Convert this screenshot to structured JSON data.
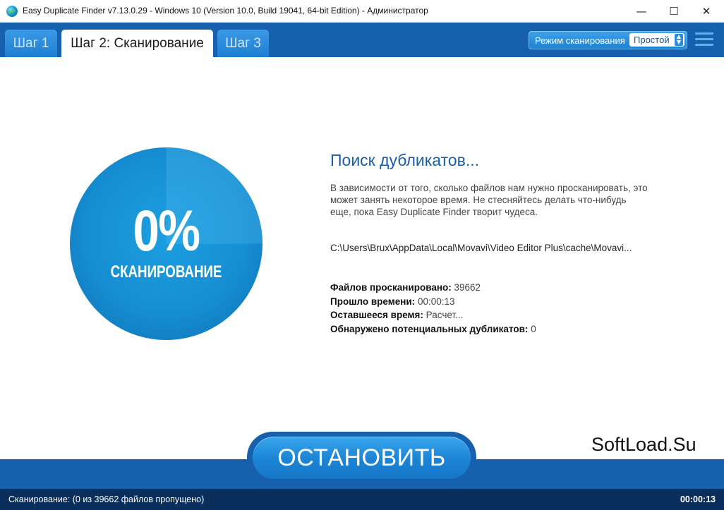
{
  "window": {
    "title": "Easy Duplicate Finder v7.13.0.29 - Windows 10 (Version 10.0, Build 19041, 64-bit Edition) - Администратор",
    "minimize_glyph": "—",
    "maximize_glyph": "☐",
    "close_glyph": "✕"
  },
  "tabs": [
    {
      "label": "Шаг 1",
      "active": false
    },
    {
      "label": "Шаг 2: Сканирование",
      "active": true
    },
    {
      "label": "Шаг 3",
      "active": false
    }
  ],
  "scan_mode": {
    "label": "Режим сканирования",
    "value": "Простой"
  },
  "progress": {
    "percent_text": "0%",
    "percent_value": 0,
    "label": "СКАНИРОВАНИЕ"
  },
  "info": {
    "heading": "Поиск дубликатов...",
    "description": "В зависимости от того, сколько файлов нам нужно просканировать, это может занять некоторое время. Не стесняйтесь делать что-нибудь еще, пока Easy Duplicate Finder творит чудеса.",
    "current_path": "C:\\Users\\Brux\\AppData\\Local\\Movavi\\Video Editor Plus\\cache\\Movavi..."
  },
  "stats": {
    "scanned_label": "Файлов просканировано:",
    "scanned_value": "39662",
    "elapsed_label": "Прошло времени:",
    "elapsed_value": "00:00:13",
    "remaining_label": "Оставшееся время:",
    "remaining_value": "Расчет...",
    "duplicates_label": "Обнаружено потенциальных дубликатов:",
    "duplicates_value": "0"
  },
  "stop_button": "ОСТАНОВИТЬ",
  "watermark": "SoftLoad.Su",
  "status": {
    "left": "Сканирование: (0 из 39662 файлов пропущено)",
    "right": "00:00:13"
  },
  "colors": {
    "brand_blue": "#1660ad",
    "circle_blue": "#168ed3",
    "status_dark": "#0a2f5c"
  }
}
